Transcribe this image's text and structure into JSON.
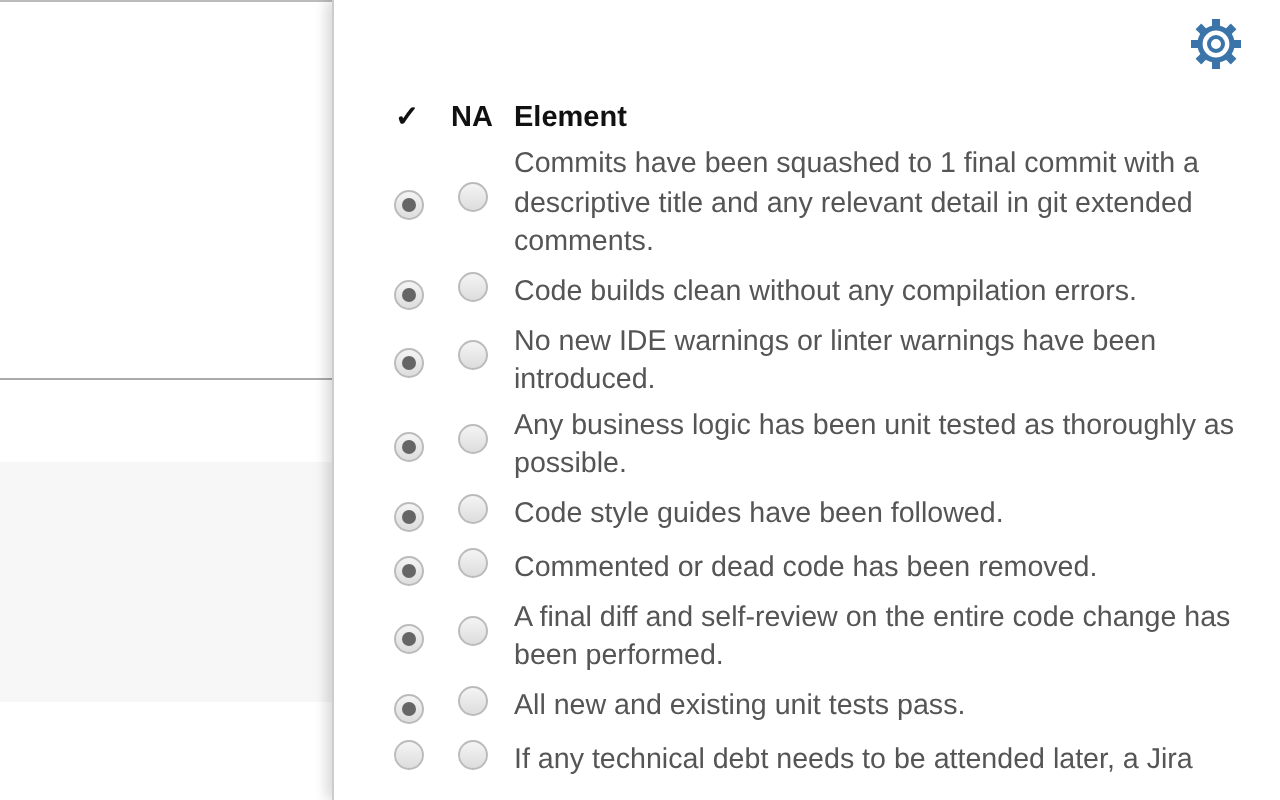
{
  "columns": {
    "done": "✓",
    "na": "NA",
    "element": "Element"
  },
  "items": [
    {
      "text": "Commits have been squashed to 1 final commit with a descriptive title and any relevant detail in git extended comments.",
      "done": true,
      "na": false
    },
    {
      "text": "Code builds clean without any compilation errors.",
      "done": true,
      "na": false
    },
    {
      "text": "No new IDE warnings or linter warnings have been introduced.",
      "done": true,
      "na": false
    },
    {
      "text": "Any business logic has been unit tested as thoroughly as possible.",
      "done": true,
      "na": false
    },
    {
      "text": "Code style guides have been followed.",
      "done": true,
      "na": false
    },
    {
      "text": "Commented or dead code has been removed.",
      "done": true,
      "na": false
    },
    {
      "text": "A final diff and self-review on the entire code change has been performed.",
      "done": true,
      "na": false
    },
    {
      "text": "All new and existing unit tests pass.",
      "done": true,
      "na": false
    },
    {
      "text": "If any technical debt needs to be attended later, a Jira",
      "done": false,
      "na": false
    }
  ]
}
